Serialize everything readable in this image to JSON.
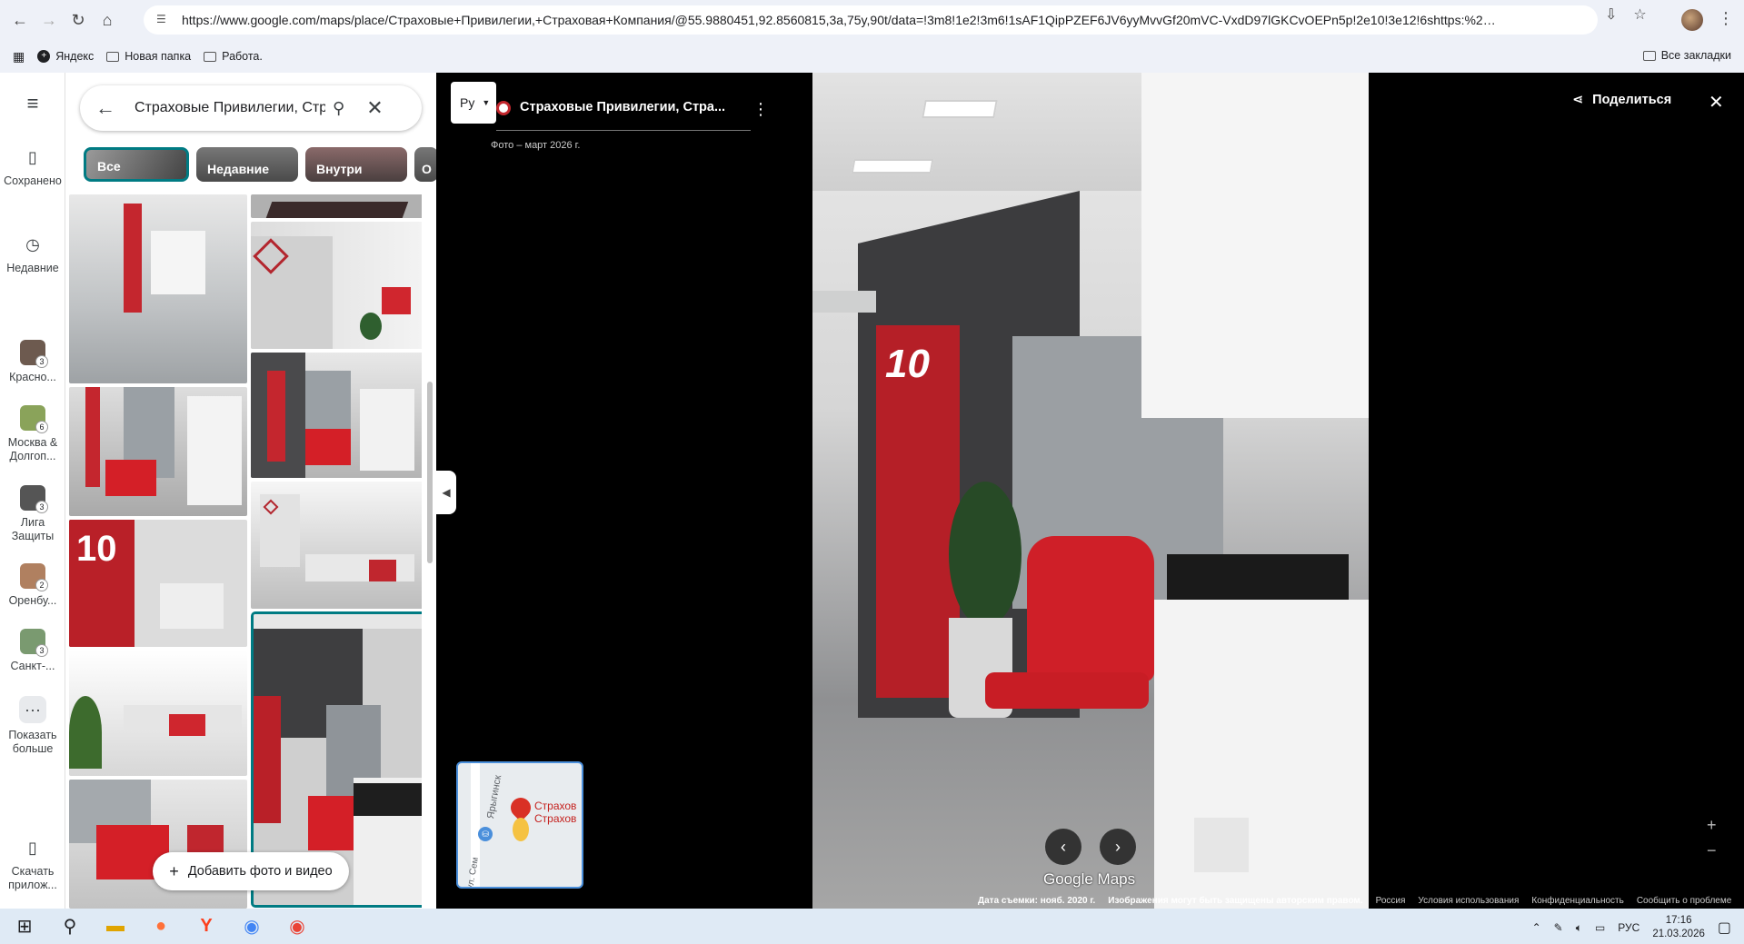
{
  "browser": {
    "url": "https://www.google.com/maps/place/Страховые+Привилегии,+Страховая+Компания/@55.9880451,92.8560815,3a,75y,90t/data=!3m8!1e2!3m6!1sAF1QipPZEF6JV6yyMvvGf20mVC-VxdD97lGKCvOEPn5p!2e10!3e12!6shttps:%2F%2Flh3.googleusercont...",
    "bookmarks": [
      "Яндекс",
      "Новая папка",
      "Работа."
    ],
    "all_bookmarks": "Все закладки"
  },
  "rail": {
    "saved": "Сохранено",
    "recent": "Недавние",
    "items": [
      {
        "label": "Красно...",
        "count": "3"
      },
      {
        "label": "Москва & Долгоп...",
        "count": "6"
      },
      {
        "label": "Лига Защиты",
        "count": "3"
      },
      {
        "label": "Оренбу...",
        "count": "2"
      },
      {
        "label": "Санкт-...",
        "count": "3"
      }
    ],
    "more": "Показать больше",
    "download": "Скачать прилож..."
  },
  "panel": {
    "search_value": "Страховые Привилегии, Стр",
    "chips": [
      "Все",
      "Недавние",
      "Внутри",
      "О"
    ],
    "add_photo": "Добавить фото и видео"
  },
  "viewer": {
    "lang": "Ру",
    "place_title": "Страховые Привилегии, Стра...",
    "photo_date": "Фото – март 2026 г.",
    "share": "Поделиться",
    "minimap_label1": "Страхов",
    "minimap_label2": "Страхов",
    "minimap_street1": "Ярыгинск",
    "minimap_street2": "ул. Сем",
    "logo": "Google Maps",
    "footer": {
      "capture_date": "Дата съемки: нояб. 2020 г.",
      "copyright": "Изображения могут быть защищены авторским правом.",
      "country": "Россия",
      "terms": "Условия использования",
      "privacy": "Конфиденциальность",
      "report": "Сообщить о проблеме"
    }
  },
  "taskbar": {
    "lang": "РУС",
    "time": "17:16",
    "date": "21.03.2026"
  }
}
